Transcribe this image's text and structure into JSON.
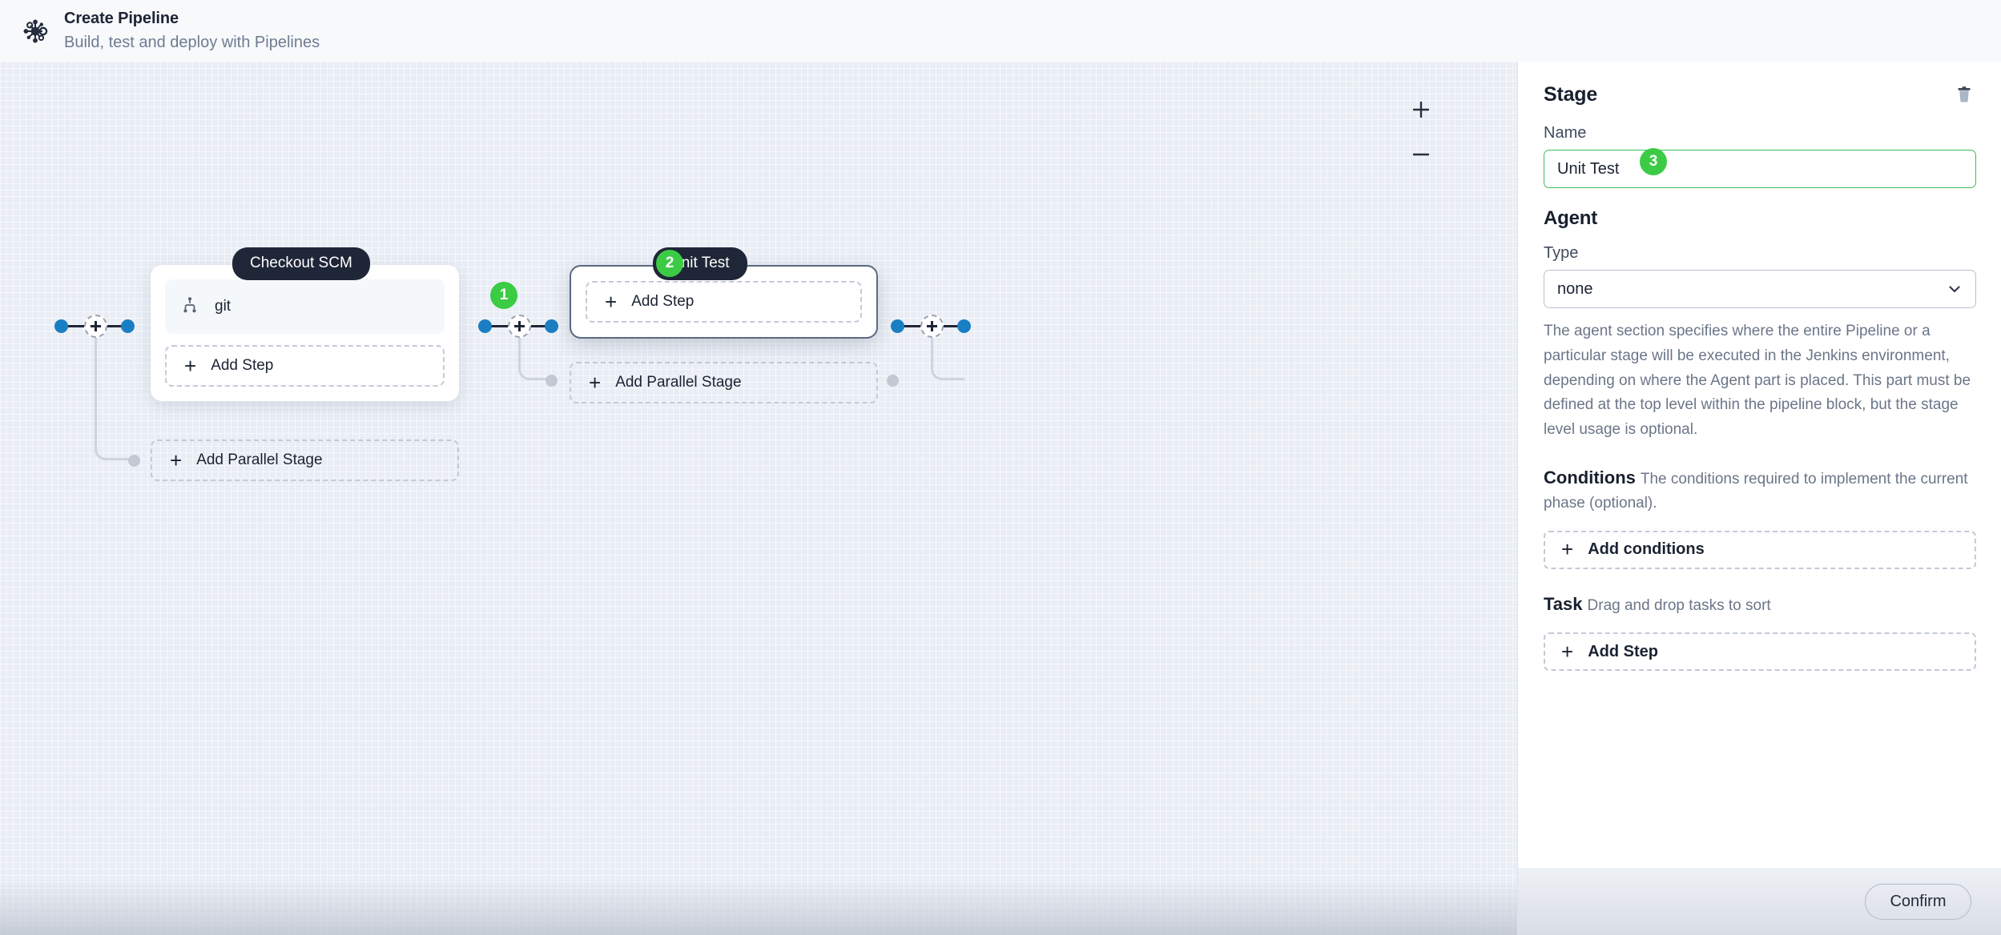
{
  "header": {
    "logo_icon": "pipeline-hub-icon",
    "title": "Create Pipeline",
    "subtitle": "Build, test and deploy with Pipelines",
    "close_icon": "close-icon"
  },
  "canvas": {
    "zoom_in_icon": "plus-icon",
    "zoom_out_icon": "minus-icon",
    "stages": [
      {
        "label": "Checkout SCM",
        "badge": null,
        "selected": false,
        "steps": [
          {
            "icon": "git-branch-icon",
            "label": "git"
          }
        ],
        "add_step_label": "Add Step",
        "add_parallel_label": "Add Parallel Stage"
      },
      {
        "label": "Unit Test",
        "badge": "2",
        "selected": true,
        "steps": [],
        "add_step_label": "Add Step",
        "add_parallel_label": "Add Parallel Stage"
      }
    ],
    "connector_badge": "1"
  },
  "panel": {
    "title": "Stage",
    "delete_icon": "trash-icon",
    "name_label": "Name",
    "name_value": "Unit Test",
    "name_badge": "3",
    "agent_heading": "Agent",
    "type_label": "Type",
    "type_value": "none",
    "type_caret_icon": "chevron-down-icon",
    "agent_description": "The agent section specifies where the entire Pipeline or a particular stage will be executed in the Jenkins environment, depending on where the Agent part is placed. This part must be defined at the top level within the pipeline block, but the stage level usage is optional.",
    "conditions_heading": "Conditions",
    "conditions_description": "The conditions required to implement the current phase (optional).",
    "add_conditions_label": "Add conditions",
    "task_heading": "Task",
    "task_description": "Drag and drop tasks to sort",
    "add_step_label": "Add Step",
    "confirm_label": "Confirm"
  },
  "colors": {
    "accent_green": "#3ccb45",
    "node_blue": "#1a7ec2",
    "dark": "#1f2637",
    "canvas_bg": "#e9edf5"
  }
}
